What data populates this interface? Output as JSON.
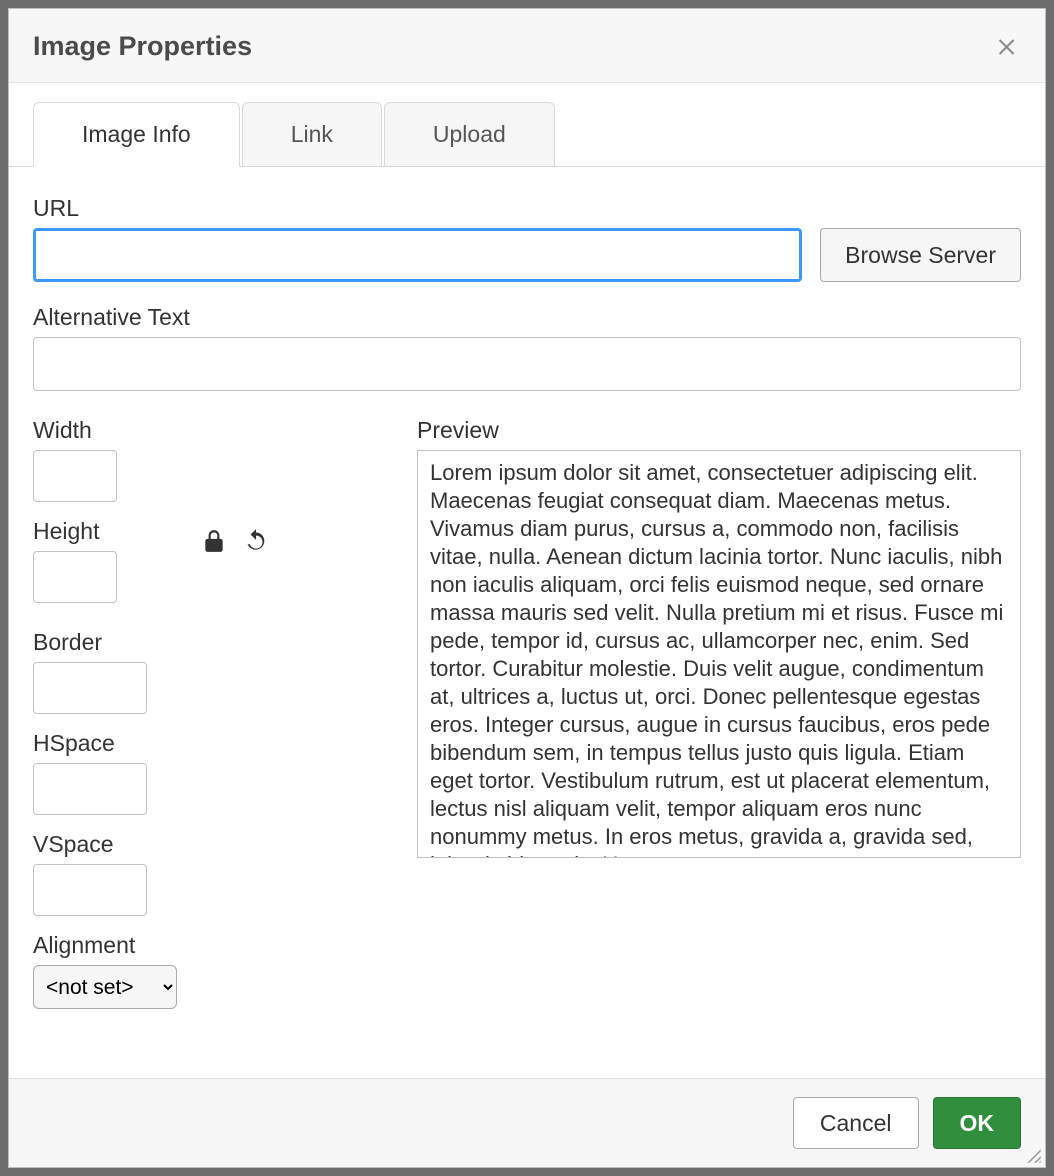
{
  "dialog": {
    "title": "Image Properties",
    "tabs": [
      {
        "label": "Image Info",
        "active": true
      },
      {
        "label": "Link",
        "active": false
      },
      {
        "label": "Upload",
        "active": false
      }
    ],
    "fields": {
      "url": {
        "label": "URL",
        "value": ""
      },
      "browse_server": "Browse Server",
      "alt": {
        "label": "Alternative Text",
        "value": ""
      },
      "width": {
        "label": "Width",
        "value": ""
      },
      "height": {
        "label": "Height",
        "value": ""
      },
      "border": {
        "label": "Border",
        "value": ""
      },
      "hspace": {
        "label": "HSpace",
        "value": ""
      },
      "vspace": {
        "label": "VSpace",
        "value": ""
      },
      "alignment": {
        "label": "Alignment",
        "selected": "<not set>"
      },
      "preview": {
        "label": "Preview",
        "text": "Lorem ipsum dolor sit amet, consectetuer adipiscing elit. Maecenas feugiat consequat diam. Maecenas metus. Vivamus diam purus, cursus a, commodo non, facilisis vitae, nulla. Aenean dictum lacinia tortor. Nunc iaculis, nibh non iaculis aliquam, orci felis euismod neque, sed ornare massa mauris sed velit. Nulla pretium mi et risus. Fusce mi pede, tempor id, cursus ac, ullamcorper nec, enim. Sed tortor. Curabitur molestie. Duis velit augue, condimentum at, ultrices a, luctus ut, orci. Donec pellentesque egestas eros. Integer cursus, augue in cursus faucibus, eros pede bibendum sem, in tempus tellus justo quis ligula. Etiam eget tortor. Vestibulum rutrum, est ut placerat elementum, lectus nisl aliquam velit, tempor aliquam eros nunc nonummy metus. In eros metus, gravida a, gravida sed, lobortis id, turpis. Ut"
      }
    },
    "buttons": {
      "cancel": "Cancel",
      "ok": "OK"
    }
  }
}
